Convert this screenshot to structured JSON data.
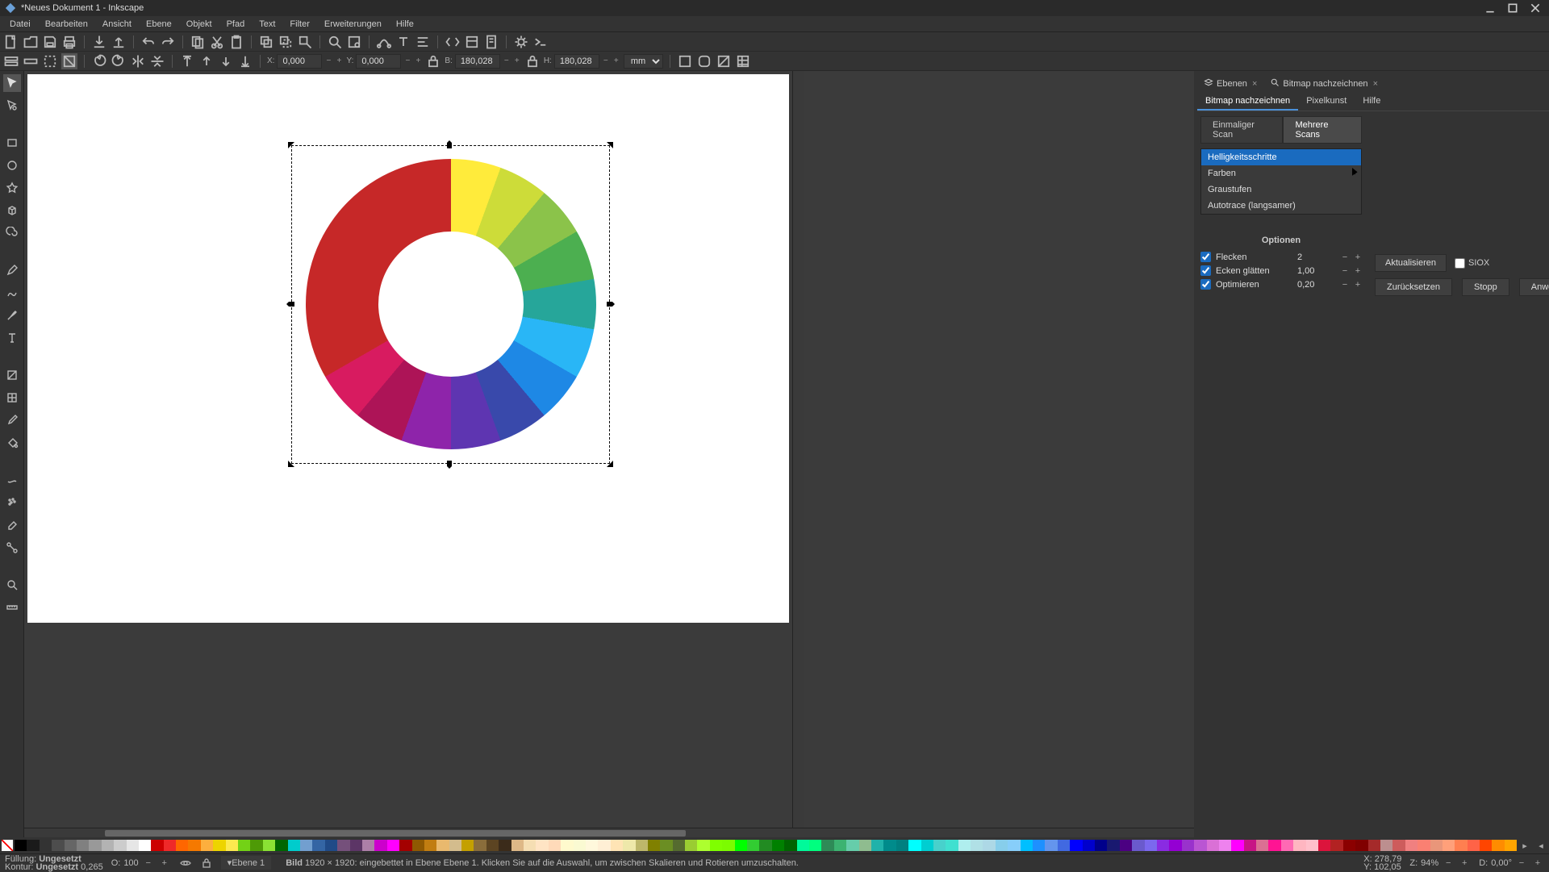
{
  "title": "*Neues Dokument 1 - Inkscape",
  "menu": [
    "Datei",
    "Bearbeiten",
    "Ansicht",
    "Ebene",
    "Objekt",
    "Pfad",
    "Text",
    "Filter",
    "Erweiterungen",
    "Hilfe"
  ],
  "toolbar2": {
    "x_label": "X:",
    "x": "0,000",
    "y_label": "Y:",
    "y": "0,000",
    "w_label": "B:",
    "w": "180,028",
    "h_label": "H:",
    "h": "180,028",
    "unit": "mm"
  },
  "dock": {
    "tab_layers": "Ebenen",
    "tab_trace": "Bitmap nachzeichnen",
    "sub_trace": "Bitmap nachzeichnen",
    "sub_pixel": "Pixelkunst",
    "sub_help": "Hilfe",
    "mode_single": "Einmaliger Scan",
    "mode_multi": "Mehrere Scans",
    "dropdown": {
      "items": [
        "Helligkeitsschritte",
        "Farben",
        "Graustufen",
        "Autotrace (langsamer)"
      ],
      "selected": 0
    },
    "options": {
      "header": "Optionen",
      "flecken": {
        "label": "Flecken",
        "value": "2"
      },
      "ecken": {
        "label": "Ecken glätten",
        "value": "1,00"
      },
      "opt": {
        "label": "Optimieren",
        "value": "0,20"
      }
    },
    "update": "Aktualisieren",
    "siox": "SIOX",
    "reset": "Zurücksetzen",
    "stop": "Stopp",
    "apply": "Anwenden"
  },
  "status": {
    "fill_label": "Füllung:",
    "fill_value": "Ungesetzt",
    "stroke_label": "Kontur:",
    "stroke_value": "Ungesetzt",
    "stroke_w": "0,265",
    "opacity_label": "O:",
    "opacity": "100",
    "layer": "▾Ebene 1",
    "sel_kind": "Bild",
    "sel_dims": "1920 × 1920:",
    "sel_msg": "eingebettet in Ebene Ebene 1. Klicken Sie auf die Auswahl, um zwischen Skalieren und Rotieren umzuschalten.",
    "xy_label_x": "X:",
    "xy_x": "278,79",
    "xy_label_y": "Y:",
    "xy_y": "102,05",
    "zoom_label": "Z:",
    "zoom": "94%",
    "rot_label": "D:",
    "rot": "0,00°"
  },
  "palette_hues": [
    "#000000",
    "#1a1a1a",
    "#333333",
    "#4d4d4d",
    "#666666",
    "#808080",
    "#999999",
    "#b3b3b3",
    "#cccccc",
    "#e6e6e6",
    "#ffffff",
    "#cc0000",
    "#ef2929",
    "#ff6600",
    "#f57900",
    "#fcaf3e",
    "#edd400",
    "#fce94f",
    "#73d216",
    "#4e9a06",
    "#8ae234",
    "#006600",
    "#00cccc",
    "#729fcf",
    "#3465a4",
    "#204a87",
    "#75507b",
    "#5c3566",
    "#ad7fa8",
    "#cc00cc",
    "#ff00ff",
    "#a40000",
    "#8f5902",
    "#c17d11",
    "#e9b96e",
    "#d3bc8d",
    "#c4a000",
    "#8a6d3b",
    "#5c4422",
    "#3b2b1a",
    "#deb887",
    "#f5deb3",
    "#ffe4c4",
    "#ffdab9",
    "#fffacd",
    "#fafad2",
    "#fff8dc",
    "#ffefd5",
    "#ffe4b5",
    "#eee8aa",
    "#bdb76b",
    "#808000",
    "#6b8e23",
    "#556b2f",
    "#9acd32",
    "#adff2f",
    "#7fff00",
    "#7cfc00",
    "#00ff00",
    "#32cd32",
    "#228b22",
    "#008000",
    "#006400",
    "#00fa9a",
    "#00ff7f",
    "#2e8b57",
    "#3cb371",
    "#66cdaa",
    "#8fbc8f",
    "#20b2aa",
    "#008b8b",
    "#008080",
    "#00ffff",
    "#00ced1",
    "#48d1cc",
    "#40e0d0",
    "#afeeee",
    "#b0e0e6",
    "#add8e6",
    "#87ceeb",
    "#87cefa",
    "#00bfff",
    "#1e90ff",
    "#6495ed",
    "#4169e1",
    "#0000ff",
    "#0000cd",
    "#00008b",
    "#191970",
    "#4b0082",
    "#6a5acd",
    "#7b68ee",
    "#8a2be2",
    "#9400d3",
    "#9932cc",
    "#ba55d3",
    "#da70d6",
    "#ee82ee",
    "#ff00ff",
    "#c71585",
    "#db7093",
    "#ff1493",
    "#ff69b4",
    "#ffb6c1",
    "#ffc0cb",
    "#dc143c",
    "#b22222",
    "#8b0000",
    "#800000",
    "#a52a2a",
    "#bc8f8f",
    "#cd5c5c",
    "#f08080",
    "#fa8072",
    "#e9967a",
    "#ffa07a",
    "#ff7f50",
    "#ff6347",
    "#ff4500",
    "#ff8c00",
    "#ffa500"
  ],
  "wheel_segments": [
    "#e53935",
    "#f4511e",
    "#fb8c00",
    "#ffb300",
    "#fdd835",
    "#ffeb3b",
    "#cddc39",
    "#8bc34a",
    "#4caf50",
    "#26a69a",
    "#29b6f6",
    "#1e88e5",
    "#3949ab",
    "#5e35b1",
    "#8e24aa",
    "#ad1457",
    "#d81b60",
    "#c62828"
  ]
}
